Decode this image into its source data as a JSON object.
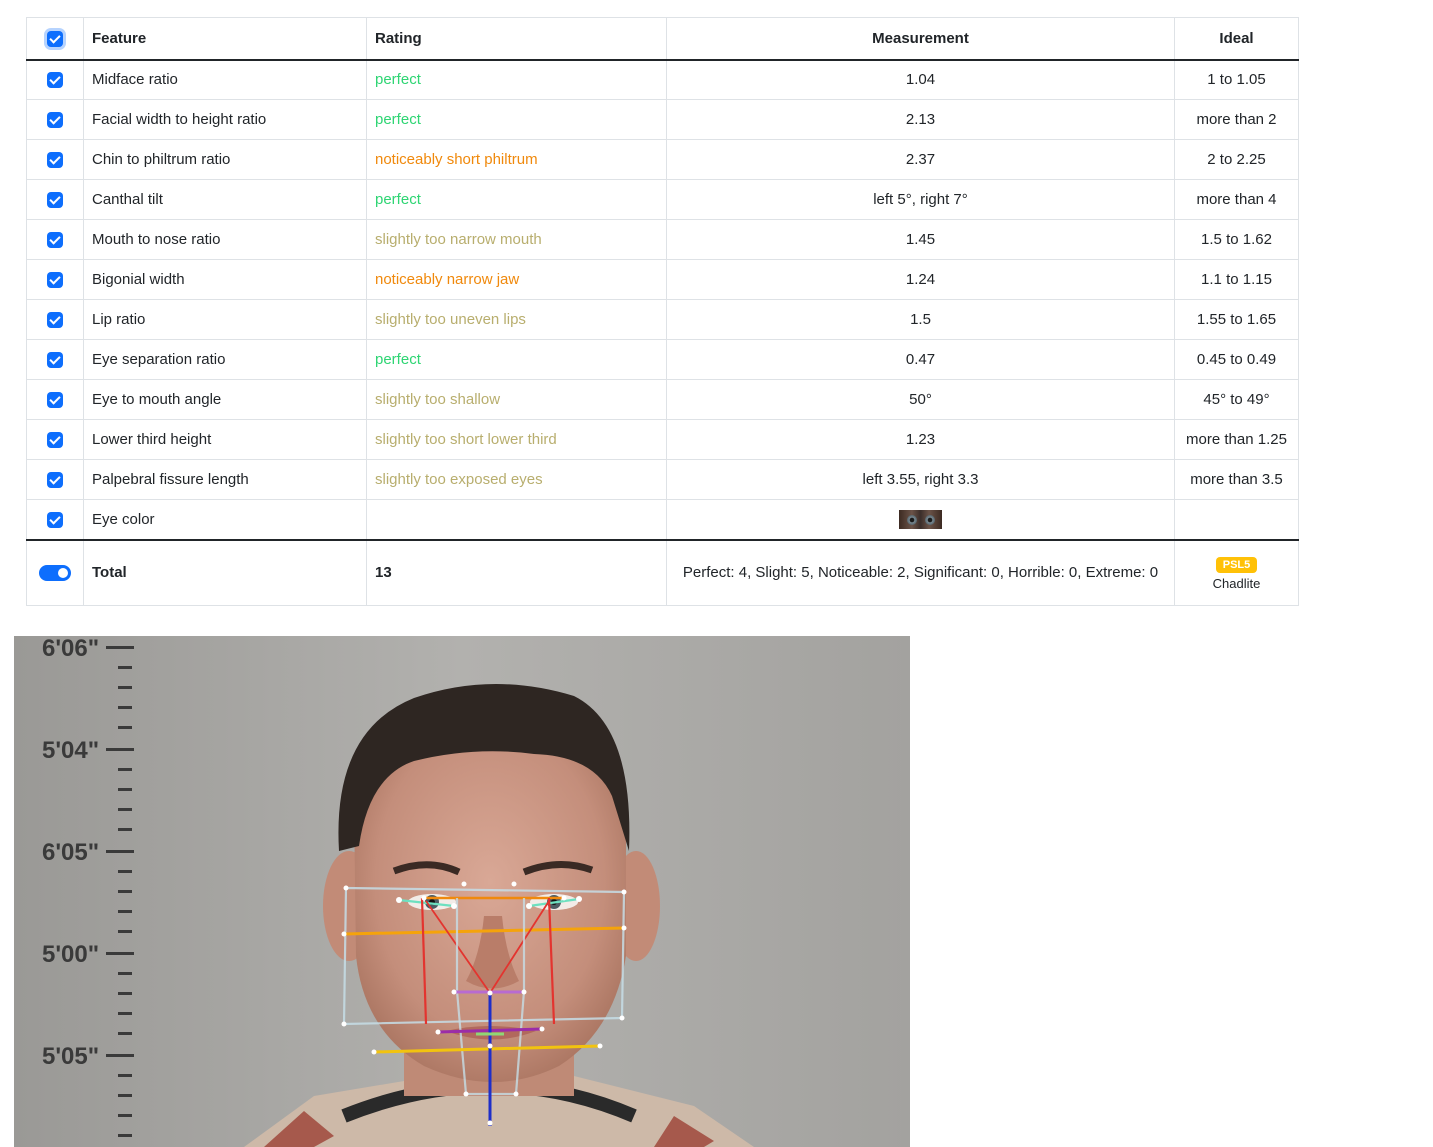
{
  "table": {
    "headers": {
      "feature": "Feature",
      "rating": "Rating",
      "measurement": "Measurement",
      "ideal": "Ideal"
    },
    "rows": [
      {
        "feature": "Midface ratio",
        "rating": "perfect",
        "rating_color": "#2ed573",
        "measurement": "1.04",
        "ideal": "1 to 1.05"
      },
      {
        "feature": "Facial width to height ratio",
        "rating": "perfect",
        "rating_color": "#2ed573",
        "measurement": "2.13",
        "ideal": "more than 2"
      },
      {
        "feature": "Chin to philtrum ratio",
        "rating": "noticeably short philtrum",
        "rating_color": "#f0890c",
        "measurement": "2.37",
        "ideal": "2 to 2.25"
      },
      {
        "feature": "Canthal tilt",
        "rating": "perfect",
        "rating_color": "#2ed573",
        "measurement": "left 5°, right 7°",
        "ideal": "more than 4"
      },
      {
        "feature": "Mouth to nose ratio",
        "rating": "slightly too narrow mouth",
        "rating_color": "#b8ae6e",
        "measurement": "1.45",
        "ideal": "1.5 to 1.62"
      },
      {
        "feature": "Bigonial width",
        "rating": "noticeably narrow jaw",
        "rating_color": "#f0890c",
        "measurement": "1.24",
        "ideal": "1.1 to 1.15"
      },
      {
        "feature": "Lip ratio",
        "rating": "slightly too uneven lips",
        "rating_color": "#b8ae6e",
        "measurement": "1.5",
        "ideal": "1.55 to 1.65"
      },
      {
        "feature": "Eye separation ratio",
        "rating": "perfect",
        "rating_color": "#2ed573",
        "measurement": "0.47",
        "ideal": "0.45 to 0.49"
      },
      {
        "feature": "Eye to mouth angle",
        "rating": "slightly too shallow",
        "rating_color": "#b8ae6e",
        "measurement": "50°",
        "ideal": "45° to 49°"
      },
      {
        "feature": "Lower third height",
        "rating": "slightly too short lower third",
        "rating_color": "#b8ae6e",
        "measurement": "1.23",
        "ideal": "more than 1.25"
      },
      {
        "feature": "Palpebral fissure length",
        "rating": "slightly too exposed eyes",
        "rating_color": "#b8ae6e",
        "measurement": "left 3.55, right 3.3",
        "ideal": "more than 3.5"
      }
    ],
    "eye_color_row": {
      "feature": "Eye color"
    },
    "total": {
      "label": "Total",
      "score": "13",
      "summary": "Perfect: 4, Slight: 5, Noticeable: 2, Significant: 0, Horrible: 0, Extreme: 0",
      "badge": "PSL5",
      "badge_color": "#ffc107",
      "tier": "Chadlite"
    }
  },
  "height_chart": {
    "marks": [
      "6'06\"",
      "5'04\"",
      "6'05\"",
      "5'00\"",
      "5'05\""
    ]
  },
  "colors": {
    "accent": "#0d6efd"
  }
}
